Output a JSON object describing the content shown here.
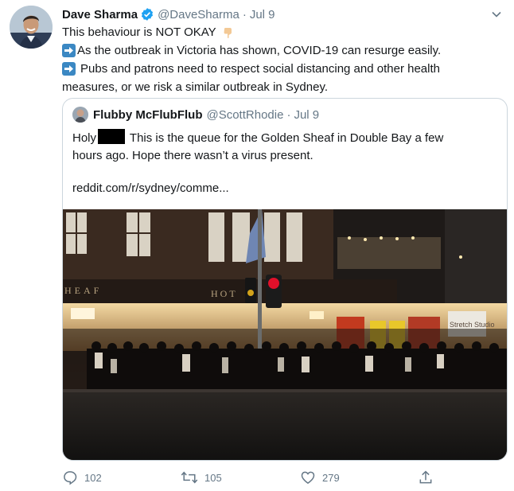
{
  "tweet": {
    "author_name": "Dave Sharma",
    "author_handle": "@DaveSharma",
    "separator": "·",
    "date": "Jul 9",
    "line1": "This behaviour is NOT OKAY",
    "line2": "As the outbreak in Victoria has shown, COVID-19 can resurge easily.",
    "line3": "Pubs and patrons need to respect social distancing and other health",
    "line4": "measures, or we risk a similar outbreak in Sydney."
  },
  "quoted": {
    "author_name": "Flubby McFlubFlub",
    "author_handle": "@ScottRhodie",
    "separator": "·",
    "date": "Jul 9",
    "text_start": "Holy",
    "text_rest": "This is the queue for the Golden Sheaf in Double Bay a few",
    "text_line2": "hours ago. Hope there wasn’t a virus present.",
    "link": "reddit.com/r/sydney/comme..."
  },
  "photo_signs": {
    "heaf": "HEAF",
    "hotel": "HOT",
    "studio": "Stretch Studio"
  },
  "actions": {
    "replies": "102",
    "retweets": "105",
    "likes": "279"
  },
  "colors": {
    "verified": "#1da1f2",
    "link": "#14171a",
    "muted": "#657786",
    "arrow_emoji": "#3b88c3",
    "traffic_red": "#e0102a"
  },
  "icons": [
    "verified-badge-icon",
    "chevron-down-icon",
    "backhand-index-pointing-down-icon",
    "right-arrow-emoji-icon",
    "reply-icon",
    "retweet-icon",
    "like-heart-icon",
    "share-icon"
  ]
}
